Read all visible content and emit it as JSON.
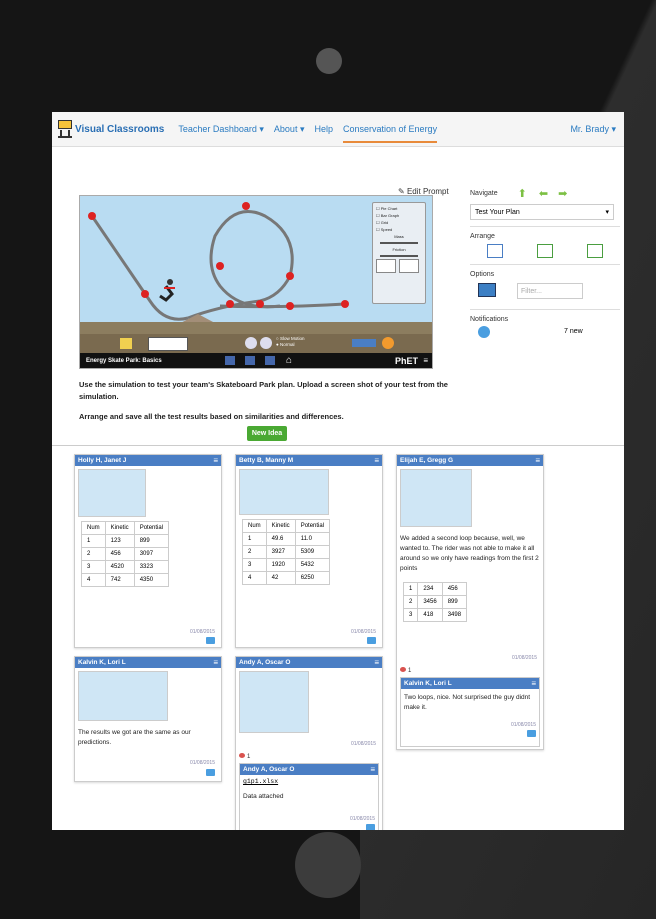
{
  "app": {
    "brand": "Visual Classrooms",
    "nav": [
      "Teacher Dashboard",
      "About",
      "Help",
      "Conservation of Energy"
    ],
    "user": "Mr. Brady"
  },
  "sim": {
    "title": "Energy Skate Park: Basics",
    "phet": "PhET",
    "panel": [
      "Pie Chart",
      "Bar Graph",
      "Grid",
      "Speed",
      "Mass",
      "Friction"
    ],
    "speed_options": [
      "Slow Motion",
      "Normal"
    ]
  },
  "edit_prompt": "Edit Prompt",
  "sidebar": {
    "navigate_label": "Navigate",
    "navigate_value": "Test Your Plan",
    "arrange_label": "Arrange",
    "options_label": "Options",
    "filter_placeholder": "Filter...",
    "notifications_label": "Notifications",
    "notifications_count": "7 new"
  },
  "instructions": {
    "line1": "Use the simulation to test your team's Skateboard Park plan.  Upload a screen shot of your test from the simulation.",
    "line2": "Arrange and save all the test results based on similarities and differences."
  },
  "new_idea": "New Idea",
  "cards": [
    {
      "author": "Holly H, Janet J",
      "table": {
        "headers": [
          "Num",
          "Kinetic",
          "Potential"
        ],
        "rows": [
          [
            "1",
            "123",
            "899"
          ],
          [
            "2",
            "456",
            "3097"
          ],
          [
            "3",
            "4520",
            "3323"
          ],
          [
            "4",
            "742",
            "4350"
          ]
        ]
      },
      "date": "01/08/2015"
    },
    {
      "author": "Betty B, Manny M",
      "table": {
        "headers": [
          "Num",
          "Kinetic",
          "Potential"
        ],
        "rows": [
          [
            "1",
            "49.6",
            "11.0"
          ],
          [
            "2",
            "3927",
            "5309"
          ],
          [
            "3",
            "1920",
            "5432"
          ],
          [
            "4",
            "42",
            "6250"
          ]
        ]
      },
      "date": "01/08/2015"
    },
    {
      "author": "Elijah E, Gregg G",
      "text": "We added a second loop because, well, we wanted to.  The rider was not able to make it all around so we only have readings from the first 2 points",
      "table": {
        "rows": [
          [
            "1",
            "234",
            "456"
          ],
          [
            "2",
            "3456",
            "899"
          ],
          [
            "3",
            "418",
            "3498"
          ]
        ]
      },
      "date": "01/08/2015",
      "reply_count": "1",
      "reply": {
        "author": "Kalvin K, Lori L",
        "text": "Two loops, nice.  Not surprised the guy didnt make it.",
        "date": "01/08/2015"
      }
    },
    {
      "author": "Kalvin K, Lori L",
      "text": "The results we got are the same as our predictions.",
      "date": "01/08/2015"
    },
    {
      "author": "Andy A, Oscar O",
      "date": "01/08/2015",
      "reply_count": "1",
      "reply": {
        "author": "Andy A, Oscar O",
        "file": "g1p1.xlsx",
        "text": "Data attached",
        "date": "01/08/2015"
      }
    }
  ]
}
